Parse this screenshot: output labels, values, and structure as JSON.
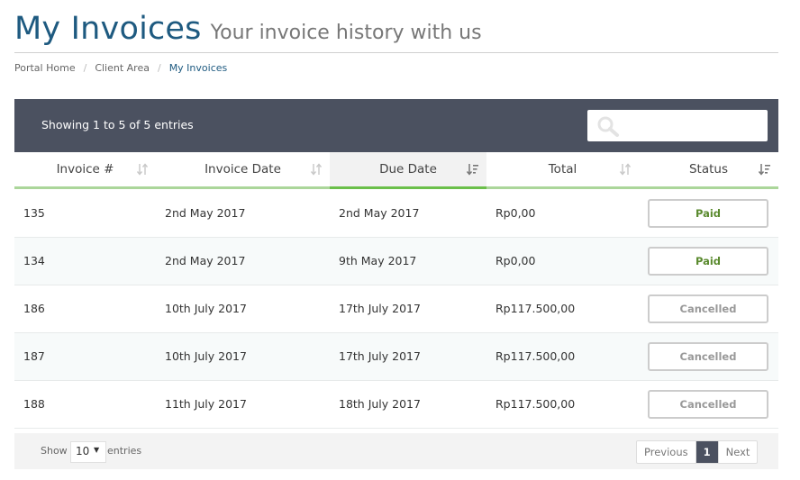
{
  "header": {
    "title": "My Invoices",
    "subtitle": "Your invoice history with us"
  },
  "breadcrumb": {
    "items": [
      "Portal Home",
      "Client Area",
      "My Invoices"
    ],
    "separator": "/"
  },
  "table": {
    "info": "Showing 1 to 5 of 5 entries",
    "search_placeholder": "",
    "columns": [
      "Invoice #",
      "Invoice Date",
      "Due Date",
      "Total",
      "Status"
    ],
    "sorted_column": "Due Date",
    "rows": [
      {
        "invoice": "135",
        "invoice_date": "2nd May 2017",
        "due_date": "2nd May 2017",
        "total": "Rp0,00",
        "status": "Paid"
      },
      {
        "invoice": "134",
        "invoice_date": "2nd May 2017",
        "due_date": "9th May 2017",
        "total": "Rp0,00",
        "status": "Paid"
      },
      {
        "invoice": "186",
        "invoice_date": "10th July 2017",
        "due_date": "17th July 2017",
        "total": "Rp117.500,00",
        "status": "Cancelled"
      },
      {
        "invoice": "187",
        "invoice_date": "10th July 2017",
        "due_date": "17th July 2017",
        "total": "Rp117.500,00",
        "status": "Cancelled"
      },
      {
        "invoice": "188",
        "invoice_date": "11th July 2017",
        "due_date": "18th July 2017",
        "total": "Rp117.500,00",
        "status": "Cancelled"
      }
    ]
  },
  "footer": {
    "show_label": "Show",
    "length_value": "10",
    "entries_label": "entries",
    "pagination": {
      "previous": "Previous",
      "current": "1",
      "next": "Next"
    }
  },
  "colors": {
    "title": "#1e5a80",
    "toolbar_bg": "#4b5160",
    "header_underline": "#abd69a",
    "sorted_underline": "#6bbf4a",
    "paid": "#5a8a2e",
    "cancelled": "#999999"
  },
  "icons": {
    "search": "search-icon",
    "sort": "sort-icon",
    "sort_active": "sort-descending-icon",
    "select": "chevron-down-icon"
  }
}
